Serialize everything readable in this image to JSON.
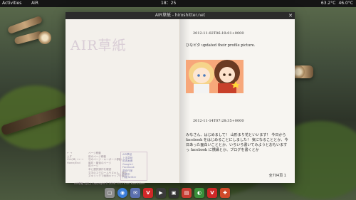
{
  "topbar": {
    "activities": "Activities",
    "app_name": "AiR",
    "clock": "18：25",
    "status": [
      "63.2°C",
      "46.0°C"
    ]
  },
  "window": {
    "title": "AIR草紙 - hiroshitter.net",
    "logo": "AIR草紙",
    "help": {
      "col1": [
        "← →",
        "ムす",
        "Ctrl(⌘) +←→",
        "Home/End"
      ],
      "col2": [
        "ページ移動",
        "前のページ移動",
        "次のページ・キーボード移動",
        "最初・最後のページ",
        "前ページ",
        "本に選択操作を確認",
        "文字のスクロールやヌキル、操作",
        "ヌキリックで画面キャップを撮る"
      ],
      "links": [
        "AIR草紙",
        "上本草紙",
        "前書画面",
        "Google+",
        "Facebook",
        "原作作家",
        "作成中",
        "作者Twitter"
      ]
    },
    "copyright": "AIR草紙 (ぼし)  Copyright © 2008-2013 Yuuri Kaenkidem",
    "posts": [
      {
        "time": "2012-11-02T06:19:01+0000",
        "text": "ひなピタ updated their profile picture."
      },
      {
        "time": "2012-11-14T07:28:35+0000",
        "text": "みなさん、はじめまして！ 山形まり花といいます！ 今日から facebook をはじめることにしました！ 気になることとか、今日あった面白いこととか、いろいろ書いてみようとおもいますっ facebook に慣縁とか、ブログを書くとか"
      }
    ],
    "page_indicator": "全704頁 1"
  },
  "dock": [
    "files",
    "chrome",
    "mail",
    "vivaldi",
    "video",
    "terminal",
    "books",
    "evince",
    "vivaldi",
    "games"
  ],
  "colors": {
    "dock": [
      "#8c8c8c",
      "#3b7dd8",
      "#5a6fae",
      "#d02828",
      "#3a3a3a",
      "#333333",
      "#c83c32",
      "#3a8f3a",
      "#d02828",
      "#d04a2a"
    ]
  }
}
